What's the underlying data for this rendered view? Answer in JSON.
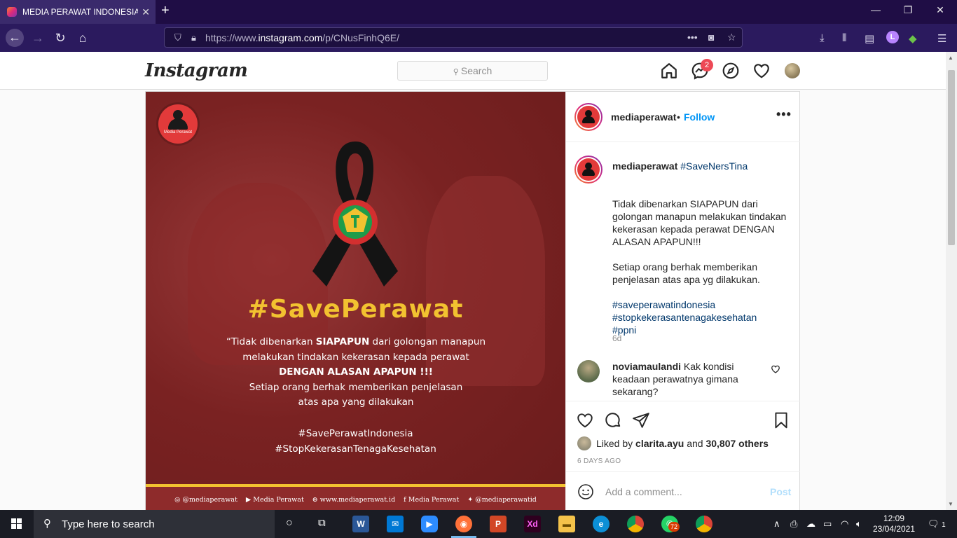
{
  "browser": {
    "tab_title": "MEDIA PERAWAT INDONESIA o",
    "url_prefix": "https://www.",
    "url_domain": "instagram.com",
    "url_path": "/p/CNusFinhQ6E/",
    "profile_letter": "L"
  },
  "instagram": {
    "logo": "Instagram",
    "search_placeholder": "Search",
    "messenger_badge": "2"
  },
  "post": {
    "image": {
      "logo_text": "Media Perawat",
      "headline": "#SavePerawat",
      "quote_lines": [
        "“Tidak dibenarkan ",
        "SIAPAPUN",
        " dari golongan manapun",
        "melakukan tindakan kekerasan kepada perawat",
        "DENGAN ALASAN APAPUN !!!",
        "Setiap orang berhak memberikan penjelasan",
        "atas apa yang dilakukan"
      ],
      "hashtags": [
        "#SavePerawatIndonesia",
        "#StopKekerasanTenagaKesehatan"
      ],
      "footer": [
        "@mediaperawat",
        "Media Perawat",
        "www.mediaperawat.id",
        "Media Perawat",
        "@mediaperawatid"
      ]
    },
    "author": "mediaperawat",
    "follow_label": "Follow",
    "caption": {
      "user": "mediaperawat",
      "tag": "#SaveNersTina",
      "body": "Tidak dibenarkan SIAPAPUN dari golongan manapun melakukan tindakan kekerasan kepada perawat DENGAN ALASAN APAPUN!!!\n\nSetiap orang berhak memberikan penjelasan atas apa yg dilakukan.",
      "hashtags": [
        "#saveperawatindonesia",
        "#stopkekerasantenagakesehatan",
        "#ppni"
      ],
      "age": "6d"
    },
    "comment": {
      "user": "noviamaulandi",
      "text": "Kak kondisi keadaan perawatnya gimana sekarang?"
    },
    "likes": {
      "prefix": "Liked by ",
      "user": "clarita.ayu",
      "middle": " and ",
      "count": "30,807 others"
    },
    "timestamp": "6 DAYS AGO",
    "add_comment_placeholder": "Add a comment...",
    "post_label": "Post"
  },
  "taskbar": {
    "search_placeholder": "Type here to search",
    "whatsapp_badge": "72",
    "time": "12:09",
    "date": "23/04/2021",
    "notification_count": "1"
  },
  "colors": {
    "browser_tabbar": "#1f0d45",
    "browser_navbar": "#2b1a5e",
    "ig_link": "#0095f6",
    "poster_red": "#7d2424",
    "poster_yellow": "#f2c230"
  }
}
